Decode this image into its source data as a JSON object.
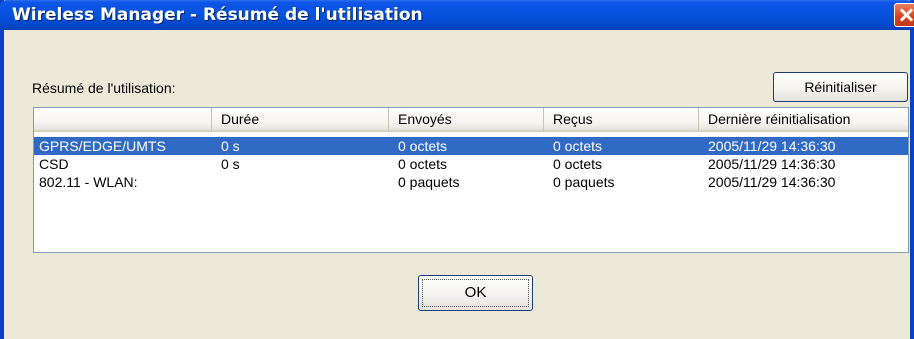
{
  "window": {
    "title": "Wireless Manager - Résumé de l'utilisation"
  },
  "summary": {
    "label": "Résumé de l'utilisation:",
    "reset_button": "Réinitialiser",
    "columns": [
      "",
      "Durée",
      "Envoyés",
      "Reçus",
      "Dernière réinitialisation"
    ],
    "rows": [
      {
        "name": "GPRS/EDGE/UMTS",
        "duration": "0 s",
        "sent": "0 octets",
        "received": "0 octets",
        "last_reset": "2005/11/29 14:36:30",
        "selected": true
      },
      {
        "name": "CSD",
        "duration": "0 s",
        "sent": "0 octets",
        "received": "0 octets",
        "last_reset": "2005/11/29 14:36:30",
        "selected": false
      },
      {
        "name": "802.11 - WLAN:",
        "duration": "",
        "sent": "0 paquets",
        "received": "0 paquets",
        "last_reset": "2005/11/29 14:36:30",
        "selected": false
      }
    ]
  },
  "footer": {
    "ok_button": "OK"
  },
  "colors": {
    "titlebar": "#0653df",
    "selection": "#316ac5",
    "dialog_bg": "#ece9d8",
    "close_button": "#d5401a"
  },
  "icons": {
    "close": "close-icon"
  }
}
